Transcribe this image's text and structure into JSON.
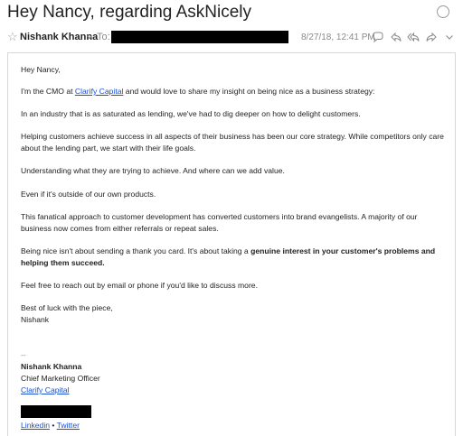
{
  "email": {
    "subject": "Hey Nancy, regarding AskNicely",
    "sender": "Nishank Khanna",
    "to_label": "To:",
    "date": "8/27/18, 12:41 PM"
  },
  "body": {
    "greeting": "Hey Nancy,",
    "p1_pre": "I'm the CMO at ",
    "p1_link": "Clarify Capital",
    "p1_post": " and would love to share my insight on being nice as a business strategy:",
    "p2": "In an industry that is as saturated as lending, we've had to dig deeper on how to delight customers.",
    "p3": "Helping customers achieve success in all aspects of their business has been our core strategy. While competitors only care about the lending part, we start with their life goals.",
    "p4": "Understanding what they are trying to achieve. And where can we add value.",
    "p5": "Even if it's outside of our own products.",
    "p6": "This fanatical approach to customer development has converted customers into brand evangelists. A majority of our business now comes from either referrals or repeat sales.",
    "p7_pre": "Being nice isn't about sending a thank you card. It's about taking a ",
    "p7_bold": "genuine interest in your customer's problems and helping them succeed.",
    "p8": "Feel free to reach out by email or phone if you'd like to discuss more.",
    "closing_1": "Best of luck with the piece,",
    "closing_2": "Nishank"
  },
  "signature": {
    "separator": "--",
    "name": "Nishank Khanna",
    "role": "Chief Marketing Officer",
    "company_link": "Clarify Capital",
    "linkedin": "Linkedin",
    "bullet": " • ",
    "twitter": "Twitter"
  },
  "icons": {
    "unread": "unread-circle-icon",
    "star": "star-icon",
    "chevron": "chevron-down-icon",
    "reply": "reply-icon",
    "reply_all": "reply-all-icon",
    "forward": "forward-icon",
    "comment": "comment-icon"
  },
  "colors": {
    "link": "#1a4fd0",
    "muted": "#8a8a8a",
    "text": "#222222"
  }
}
